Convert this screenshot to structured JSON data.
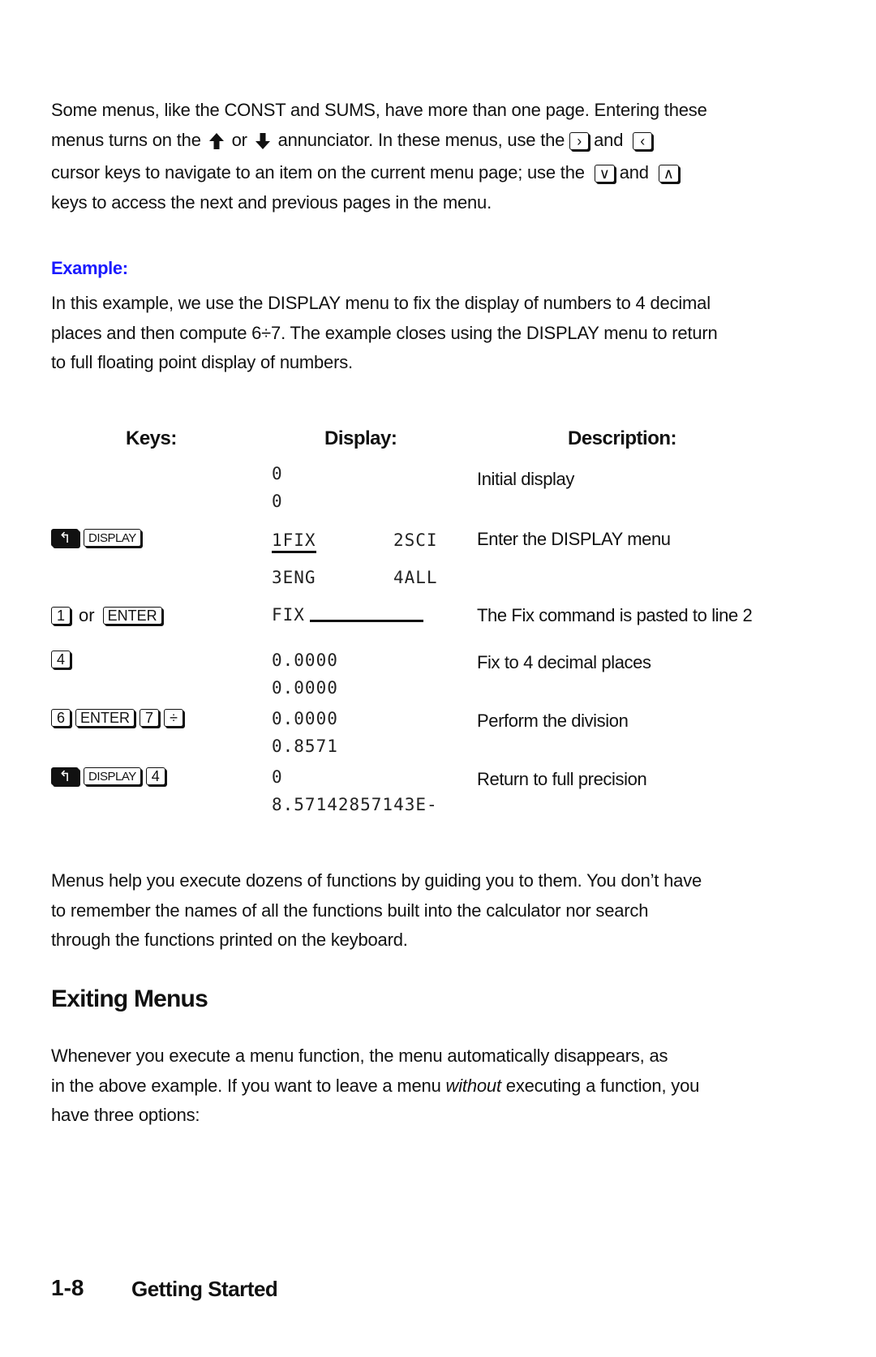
{
  "intro": {
    "line1": "Some menus, like the CONST and SUMS, have more than one page. Entering these",
    "line2_a": "menus turns on the",
    "line2_or": "or",
    "line2_b": "annunciator. In these menus, use the",
    "line2_and": "and",
    "line3_a": "cursor keys to navigate to an item on the current menu page; use the",
    "line3_and": "and",
    "line4": "keys to access the next and previous pages in the menu.",
    "icons": [
      "up-arrow-annunciator",
      "down-arrow-annunciator",
      "right-cursor-key",
      "left-cursor-key",
      "down-cursor-key",
      "up-cursor-key"
    ]
  },
  "example": {
    "label": "Example:",
    "text_lines": [
      "In this example, we use the DISPLAY menu to fix the display of numbers to 4 decimal",
      "places and then compute 6÷7. The example closes using the DISPLAY menu to return",
      "to full floating point display of numbers."
    ]
  },
  "table": {
    "headers": {
      "keys": "Keys:",
      "display": "Display:",
      "description": "Description:"
    },
    "rows": [
      {
        "keys": [],
        "display": [
          "0",
          "0"
        ],
        "description": "Initial display"
      },
      {
        "keys": [
          "shift-left",
          "DISPLAY"
        ],
        "display_menu": [
          [
            "1FIX",
            "2SCI"
          ],
          [
            "3ENG",
            "4ALL"
          ]
        ],
        "description": "Enter the DISPLAY menu"
      },
      {
        "keys": [
          "1",
          "or",
          "ENTER"
        ],
        "display": [
          "FIX"
        ],
        "description": "The Fix command is pasted to line 2"
      },
      {
        "keys": [
          "4"
        ],
        "display": [
          "0.0000",
          "0.0000"
        ],
        "description": "Fix to 4 decimal places"
      },
      {
        "keys": [
          "6",
          "ENTER",
          "7",
          "÷"
        ],
        "display": [
          "0.0000",
          "0.8571"
        ],
        "description": "Perform the division"
      },
      {
        "keys": [
          "shift-left",
          "DISPLAY",
          "4"
        ],
        "display": [
          "0",
          "8.57142857143E-"
        ],
        "description": "Return to full precision"
      }
    ]
  },
  "para_menus": [
    "Menus help you execute dozens of functions by guiding you to them. You don’t have",
    "to remember the names of all the functions built into the calculator nor search",
    "through the functions printed on the keyboard."
  ],
  "section": {
    "heading": "Exiting Menus",
    "line1": "Whenever you execute a menu function, the menu automatically disappears, as",
    "line2_a": "in the above example. If you want to leave a menu",
    "line2_em": "without",
    "line2_b": "executing a function, you",
    "line3": "have three options:"
  },
  "footer": {
    "page_number": "1-8",
    "chapter": "Getting Started"
  },
  "colors": {
    "example_label": "#1a1aff",
    "text": "#111111"
  }
}
